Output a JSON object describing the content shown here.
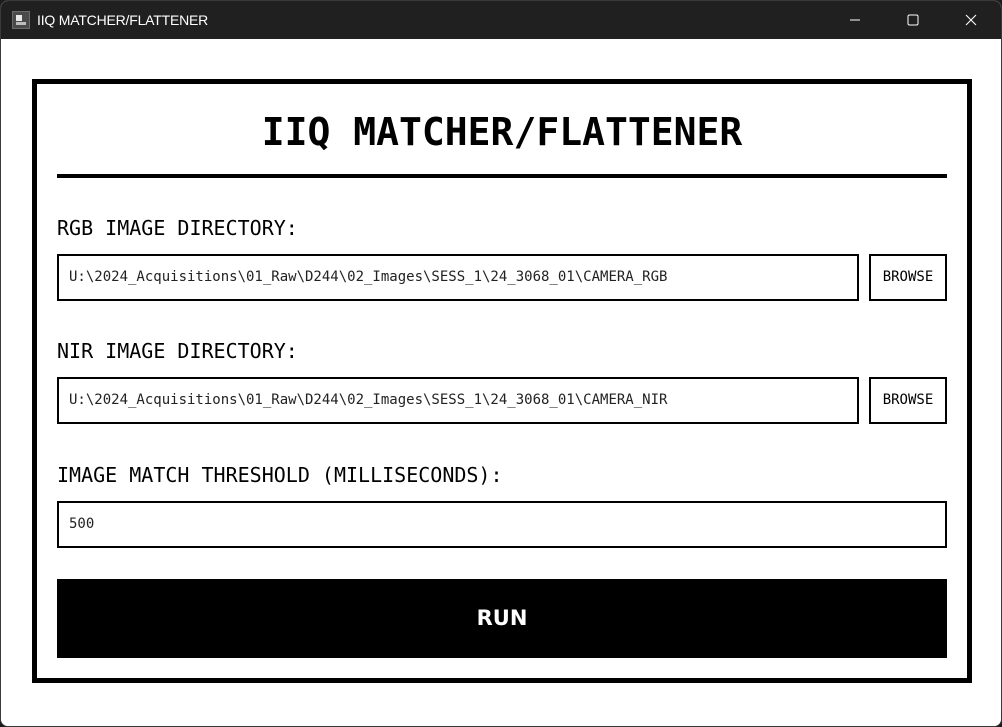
{
  "window": {
    "title": "IIQ MATCHER/FLATTENER",
    "controls": [
      "minimize-icon",
      "maximize-icon",
      "close-icon"
    ]
  },
  "app": {
    "heading": "IIQ MATCHER/FLATTENER",
    "rgb": {
      "label": "RGB IMAGE DIRECTORY:",
      "value": "U:\\2024_Acquisitions\\01_Raw\\D244\\02_Images\\SESS_1\\24_3068_01\\CAMERA_RGB",
      "browse_label": "BROWSE"
    },
    "nir": {
      "label": "NIR IMAGE DIRECTORY:",
      "value": "U:\\2024_Acquisitions\\01_Raw\\D244\\02_Images\\SESS_1\\24_3068_01\\CAMERA_NIR",
      "browse_label": "BROWSE"
    },
    "threshold": {
      "label": "IMAGE MATCH THRESHOLD (MILLISECONDS):",
      "value": "500"
    },
    "run_label": "RUN"
  },
  "colors": {
    "titlebar": "#202020",
    "accent": "#000000",
    "background": "#ffffff"
  }
}
